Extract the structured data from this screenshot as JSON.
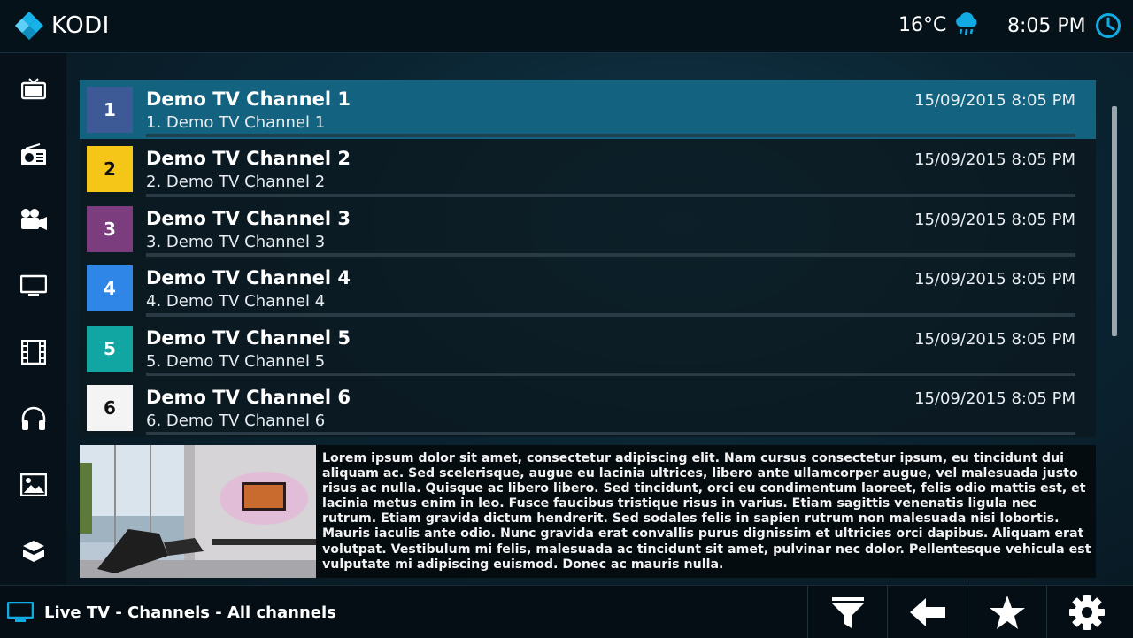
{
  "app": {
    "name": "KODI"
  },
  "header": {
    "temperature": "16°C",
    "weather_icon": "cloud-rain-icon",
    "time": "8:05 PM",
    "clock_icon": "clock-icon"
  },
  "sidebar": {
    "items": [
      {
        "name": "tv-icon"
      },
      {
        "name": "radio-icon"
      },
      {
        "name": "movie-camera-icon"
      },
      {
        "name": "monitor-icon"
      },
      {
        "name": "film-strip-icon"
      },
      {
        "name": "headphones-icon"
      },
      {
        "name": "picture-icon"
      },
      {
        "name": "addons-box-icon"
      }
    ]
  },
  "channels": [
    {
      "number": "1",
      "name": "Demo TV Channel 1",
      "subtitle": "1. Demo TV Channel 1",
      "datetime": "15/09/2015 8:05 PM",
      "color": "#3d5a96",
      "text_color": "#ffffff",
      "selected": true
    },
    {
      "number": "2",
      "name": "Demo TV Channel 2",
      "subtitle": "2. Demo TV Channel 2",
      "datetime": "15/09/2015 8:05 PM",
      "color": "#f5c518",
      "text_color": "#111111"
    },
    {
      "number": "3",
      "name": "Demo TV Channel 3",
      "subtitle": "3. Demo TV Channel 3",
      "datetime": "15/09/2015 8:05 PM",
      "color": "#7b3d7e",
      "text_color": "#ffffff"
    },
    {
      "number": "4",
      "name": "Demo TV Channel 4",
      "subtitle": "4. Demo TV Channel 4",
      "datetime": "15/09/2015 8:05 PM",
      "color": "#2f86e6",
      "text_color": "#ffffff"
    },
    {
      "number": "5",
      "name": "Demo TV Channel 5",
      "subtitle": "5. Demo TV Channel 5",
      "datetime": "15/09/2015 8:05 PM",
      "color": "#12a6a2",
      "text_color": "#ffffff"
    },
    {
      "number": "6",
      "name": "Demo TV Channel 6",
      "subtitle": "6. Demo TV Channel 6",
      "datetime": "15/09/2015 8:05 PM",
      "color": "#f4f4f4",
      "text_color": "#111111"
    }
  ],
  "info": {
    "description": "Lorem ipsum dolor sit amet, consectetur adipiscing elit. Nam cursus consectetur ipsum, eu tincidunt dui aliquam ac. Sed scelerisque, augue eu lacinia ultrices, libero ante ullamcorper augue, vel malesuada justo risus ac nulla. Quisque ac libero libero. Sed tincidunt, orci eu condimentum laoreet, felis odio mattis est, et lacinia metus enim in leo. Fusce faucibus tristique risus in varius. Etiam sagittis venenatis ligula nec rutrum. Etiam gravida dictum hendrerit. Sed sodales felis in sapien rutrum non malesuada nisi lobortis. Mauris iaculis ante odio. Nunc gravida erat convallis purus dignissim et ultricies orci dapibus. Aliquam erat volutpat. Vestibulum mi felis, malesuada ac tincidunt sit amet, pulvinar nec dolor. Pellentesque vehicula est vulputate mi adipiscing euismod. Donec ac mauris nulla."
  },
  "footer": {
    "breadcrumb": "Live TV - Channels - All channels",
    "buttons": [
      {
        "name": "filter-icon"
      },
      {
        "name": "back-arrow-icon"
      },
      {
        "name": "star-icon"
      },
      {
        "name": "settings-gear-icon"
      }
    ]
  },
  "colors": {
    "accent": "#12aae2",
    "selected_row": "#13627f"
  }
}
